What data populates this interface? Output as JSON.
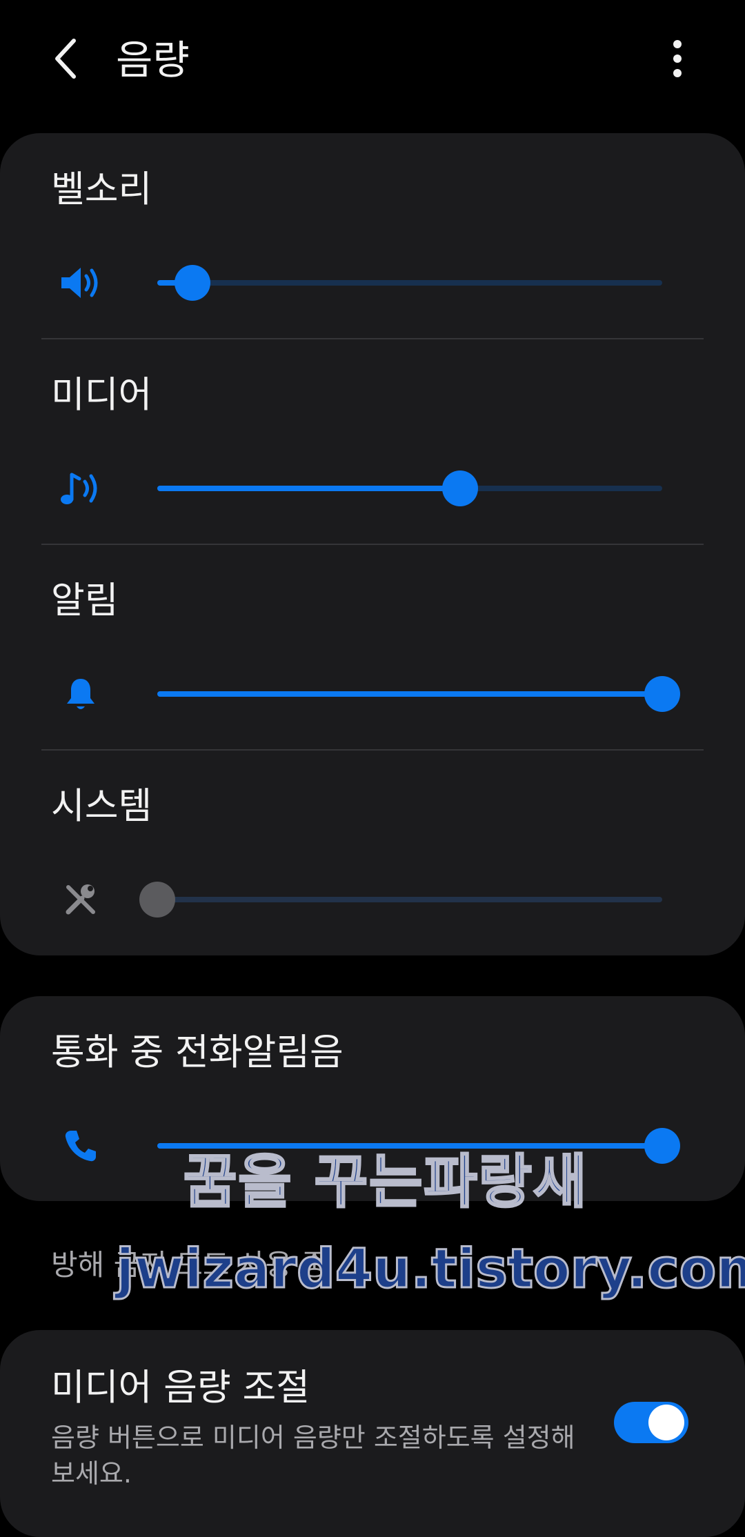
{
  "header": {
    "title": "음량",
    "back_icon": "chevron-left-icon",
    "more_icon": "more-vertical-icon"
  },
  "volume": {
    "rows": [
      {
        "label": "벨소리",
        "icon": "speaker-icon",
        "level": 0.07,
        "enabled": true
      },
      {
        "label": "미디어",
        "icon": "music-note-icon",
        "level": 0.6,
        "enabled": true
      },
      {
        "label": "알림",
        "icon": "bell-icon",
        "level": 1.0,
        "enabled": true
      },
      {
        "label": "시스템",
        "icon": "wrench-icon",
        "level": 0.0,
        "enabled": false
      }
    ]
  },
  "in_call": {
    "label": "통화 중 전화알림음",
    "icon": "phone-icon",
    "level": 1.0
  },
  "dnd_text": "방해 금지 모드 사용 중",
  "media_control": {
    "title": "미디어 음량 조절",
    "description": "음량 버튼으로 미디어 음량만 조절하도록 설정해 보세요.",
    "toggle_on": true
  },
  "watermark": {
    "line1": "꿈을 꾸는파랑새",
    "line2": "jwizard4u.tistory.com"
  },
  "colors": {
    "accent": "#0b79f2",
    "track": "#17304f",
    "card": "#1b1b1d",
    "disabled_icon": "#8a8a8e"
  }
}
